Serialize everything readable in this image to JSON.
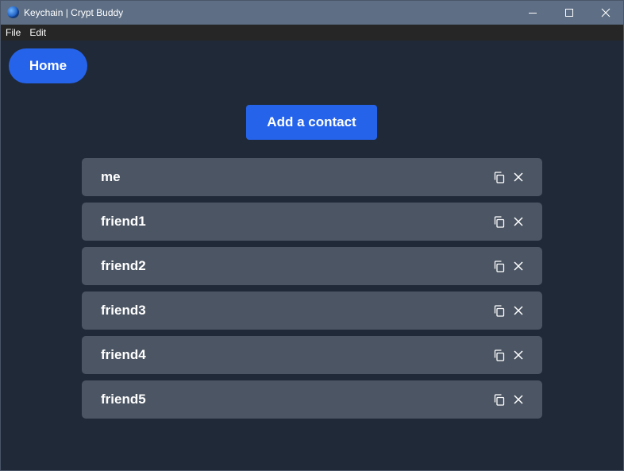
{
  "window": {
    "title": "Keychain | Crypt Buddy",
    "controls": [
      "minimize-icon",
      "maximize-icon",
      "close-icon"
    ]
  },
  "menu": {
    "items": [
      "File",
      "Edit"
    ]
  },
  "nav": {
    "home_label": "Home"
  },
  "actions": {
    "add_contact_label": "Add a contact"
  },
  "contacts": [
    {
      "name": "me"
    },
    {
      "name": "friend1"
    },
    {
      "name": "friend2"
    },
    {
      "name": "friend3"
    },
    {
      "name": "friend4"
    },
    {
      "name": "friend5"
    }
  ],
  "row_icons": [
    "copy-icon",
    "delete-icon"
  ],
  "colors": {
    "titlebar": "#5d6e85",
    "menubar": "#262626",
    "background": "#1f2937",
    "row": "#4b5563",
    "accent": "#2563eb"
  }
}
